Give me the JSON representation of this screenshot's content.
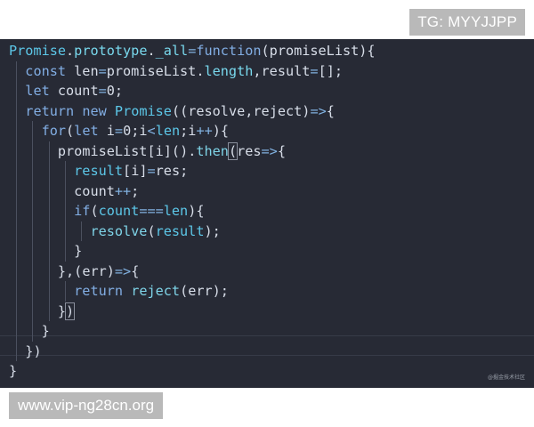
{
  "badges": {
    "top_right": "TG: MYYJJPP",
    "bottom_left": "www.vip-ng28cn.org"
  },
  "editor": {
    "watermark": "@掘金技术社区",
    "colors": {
      "background": "#272a35",
      "default_text": "#d8dee9",
      "type_cyan": "#5cc7e8",
      "keyword_blue": "#82aee4"
    },
    "lines": [
      [
        {
          "t": "Promise",
          "c": "type"
        },
        {
          "t": ".",
          "c": "punc"
        },
        {
          "t": "prototype",
          "c": "prop"
        },
        {
          "t": ".",
          "c": "punc"
        },
        {
          "t": "_all",
          "c": "prop"
        },
        {
          "t": "=",
          "c": "op"
        },
        {
          "t": "function",
          "c": "kw"
        },
        {
          "t": "(",
          "c": "punc"
        },
        {
          "t": "promiseList",
          "c": "param"
        },
        {
          "t": "){",
          "c": "punc"
        }
      ],
      [
        {
          "t": "  "
        },
        {
          "t": "const",
          "c": "kw"
        },
        {
          "t": " len",
          "c": "var"
        },
        {
          "t": "=",
          "c": "op"
        },
        {
          "t": "promiseList",
          "c": "var"
        },
        {
          "t": ".",
          "c": "punc"
        },
        {
          "t": "length",
          "c": "prop"
        },
        {
          "t": ",",
          "c": "punc"
        },
        {
          "t": "result",
          "c": "var"
        },
        {
          "t": "=",
          "c": "op"
        },
        {
          "t": "[];",
          "c": "punc"
        }
      ],
      [
        {
          "t": "  "
        },
        {
          "t": "let",
          "c": "kw"
        },
        {
          "t": " count",
          "c": "var"
        },
        {
          "t": "=",
          "c": "op"
        },
        {
          "t": "0",
          "c": "num"
        },
        {
          "t": ";",
          "c": "punc"
        }
      ],
      [
        {
          "t": "  "
        },
        {
          "t": "return",
          "c": "kw"
        },
        {
          "t": " "
        },
        {
          "t": "new",
          "c": "kw"
        },
        {
          "t": " "
        },
        {
          "t": "Promise",
          "c": "type"
        },
        {
          "t": "((",
          "c": "punc"
        },
        {
          "t": "resolve",
          "c": "param"
        },
        {
          "t": ",",
          "c": "punc"
        },
        {
          "t": "reject",
          "c": "param"
        },
        {
          "t": ")",
          "c": "punc"
        },
        {
          "t": "=>",
          "c": "op"
        },
        {
          "t": "{",
          "c": "punc"
        }
      ],
      [
        {
          "t": "    "
        },
        {
          "t": "for",
          "c": "kw"
        },
        {
          "t": "(",
          "c": "punc"
        },
        {
          "t": "let",
          "c": "kw"
        },
        {
          "t": " i",
          "c": "var"
        },
        {
          "t": "=",
          "c": "op"
        },
        {
          "t": "0",
          "c": "num"
        },
        {
          "t": ";",
          "c": "punc"
        },
        {
          "t": "i",
          "c": "var"
        },
        {
          "t": "<",
          "c": "op"
        },
        {
          "t": "len",
          "c": "type"
        },
        {
          "t": ";",
          "c": "punc"
        },
        {
          "t": "i",
          "c": "var"
        },
        {
          "t": "++",
          "c": "op"
        },
        {
          "t": "){",
          "c": "punc"
        }
      ],
      [
        {
          "t": "      "
        },
        {
          "t": "promiseList",
          "c": "var"
        },
        {
          "t": "[",
          "c": "punc"
        },
        {
          "t": "i",
          "c": "var"
        },
        {
          "t": "]().",
          "c": "punc"
        },
        {
          "t": "then",
          "c": "func"
        },
        {
          "t": "(",
          "c": "punc",
          "box": true
        },
        {
          "t": "res",
          "c": "param"
        },
        {
          "t": "=>",
          "c": "op"
        },
        {
          "t": "{",
          "c": "punc"
        }
      ],
      [
        {
          "t": "        "
        },
        {
          "t": "result",
          "c": "type"
        },
        {
          "t": "[",
          "c": "punc"
        },
        {
          "t": "i",
          "c": "var"
        },
        {
          "t": "]",
          "c": "punc"
        },
        {
          "t": "=",
          "c": "op"
        },
        {
          "t": "res",
          "c": "var"
        },
        {
          "t": ";",
          "c": "punc"
        }
      ],
      [
        {
          "t": "        "
        },
        {
          "t": "count",
          "c": "var"
        },
        {
          "t": "++",
          "c": "op"
        },
        {
          "t": ";",
          "c": "punc"
        }
      ],
      [
        {
          "t": "        "
        },
        {
          "t": "if",
          "c": "kw"
        },
        {
          "t": "(",
          "c": "punc"
        },
        {
          "t": "count",
          "c": "type"
        },
        {
          "t": "===",
          "c": "op"
        },
        {
          "t": "len",
          "c": "type"
        },
        {
          "t": "){",
          "c": "punc"
        }
      ],
      [
        {
          "t": "          "
        },
        {
          "t": "resolve",
          "c": "func"
        },
        {
          "t": "(",
          "c": "punc"
        },
        {
          "t": "result",
          "c": "type"
        },
        {
          "t": ");",
          "c": "punc"
        }
      ],
      [
        {
          "t": "        "
        },
        {
          "t": "}",
          "c": "punc"
        }
      ],
      [
        {
          "t": "      "
        },
        {
          "t": "},(",
          "c": "punc"
        },
        {
          "t": "err",
          "c": "param"
        },
        {
          "t": ")",
          "c": "punc"
        },
        {
          "t": "=>",
          "c": "op"
        },
        {
          "t": "{",
          "c": "punc"
        }
      ],
      [
        {
          "t": "        "
        },
        {
          "t": "return",
          "c": "kw"
        },
        {
          "t": " "
        },
        {
          "t": "reject",
          "c": "func"
        },
        {
          "t": "(",
          "c": "punc"
        },
        {
          "t": "err",
          "c": "var"
        },
        {
          "t": ");",
          "c": "punc"
        }
      ],
      [
        {
          "t": "      "
        },
        {
          "t": "}",
          "c": "punc"
        },
        {
          "t": ")",
          "c": "punc",
          "box": true
        }
      ],
      [
        {
          "t": "    "
        },
        {
          "t": "}",
          "c": "punc"
        }
      ],
      [
        {
          "t": "  "
        },
        {
          "t": "})",
          "c": "punc"
        }
      ],
      [
        {
          "t": "}",
          "c": "punc"
        }
      ]
    ]
  }
}
